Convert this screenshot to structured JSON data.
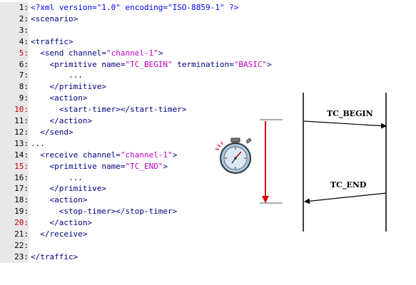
{
  "colors": {
    "tag": "#000080",
    "string": "#c000c0",
    "decl": "#0000ff",
    "red_line": "#c00000",
    "arrow": "#e00000",
    "gutter": "#e8e8e8"
  },
  "code_lines": [
    {
      "n": "1:",
      "red": false,
      "segs": [
        {
          "t": "<?xml version=\"1.0\" encoding=\"ISO-8859-1\" ?>",
          "c": "decl"
        }
      ]
    },
    {
      "n": "2:",
      "red": false,
      "segs": [
        {
          "t": "<scenario>",
          "c": "tag"
        }
      ]
    },
    {
      "n": "3:",
      "red": false,
      "segs": []
    },
    {
      "n": "4:",
      "red": false,
      "segs": [
        {
          "t": "<traffic>",
          "c": "tag"
        }
      ]
    },
    {
      "n": "5:",
      "red": true,
      "segs": [
        {
          "t": "  <send channel=",
          "c": "tag"
        },
        {
          "t": "\"channel-1\"",
          "c": "string"
        },
        {
          "t": ">",
          "c": "tag"
        }
      ]
    },
    {
      "n": "6:",
      "red": false,
      "segs": [
        {
          "t": "    <primitive name=",
          "c": "tag"
        },
        {
          "t": "\"TC_BEGIN\"",
          "c": "string"
        },
        {
          "t": " termination=",
          "c": "tag"
        },
        {
          "t": "\"BASIC\"",
          "c": "string"
        },
        {
          "t": ">",
          "c": "tag"
        }
      ]
    },
    {
      "n": "7:",
      "red": false,
      "segs": [
        {
          "t": "        ...",
          "c": "plain"
        }
      ]
    },
    {
      "n": "8:",
      "red": false,
      "segs": [
        {
          "t": "    </primitive>",
          "c": "tag"
        }
      ]
    },
    {
      "n": "9:",
      "red": false,
      "segs": [
        {
          "t": "    <action>",
          "c": "tag"
        }
      ]
    },
    {
      "n": "10:",
      "red": true,
      "segs": [
        {
          "t": "      <start-timer></start-timer>",
          "c": "tag"
        }
      ]
    },
    {
      "n": "11:",
      "red": false,
      "segs": [
        {
          "t": "    </action>",
          "c": "tag"
        }
      ]
    },
    {
      "n": "12:",
      "red": false,
      "segs": [
        {
          "t": "  </send>",
          "c": "tag"
        }
      ]
    },
    {
      "n": "13:",
      "red": false,
      "segs": [
        {
          "t": "...",
          "c": "plain"
        }
      ]
    },
    {
      "n": "14:",
      "red": false,
      "segs": [
        {
          "t": "  <receive channel=",
          "c": "tag"
        },
        {
          "t": "\"channel-1\"",
          "c": "string"
        },
        {
          "t": ">",
          "c": "tag"
        }
      ]
    },
    {
      "n": "15:",
      "red": true,
      "segs": [
        {
          "t": "    <primitive name=",
          "c": "tag"
        },
        {
          "t": "\"TC_END\"",
          "c": "string"
        },
        {
          "t": ">",
          "c": "tag"
        }
      ]
    },
    {
      "n": "16:",
      "red": false,
      "segs": [
        {
          "t": "        ...",
          "c": "plain"
        }
      ]
    },
    {
      "n": "17:",
      "red": false,
      "segs": [
        {
          "t": "    </primitive>",
          "c": "tag"
        }
      ]
    },
    {
      "n": "18:",
      "red": false,
      "segs": [
        {
          "t": "    <action>",
          "c": "tag"
        }
      ]
    },
    {
      "n": "19:",
      "red": false,
      "segs": [
        {
          "t": "      <stop-timer></stop-timer>",
          "c": "tag"
        }
      ]
    },
    {
      "n": "20:",
      "red": true,
      "segs": [
        {
          "t": "    </action>",
          "c": "tag"
        }
      ]
    },
    {
      "n": "21:",
      "red": false,
      "segs": [
        {
          "t": "  </receive>",
          "c": "tag"
        }
      ]
    },
    {
      "n": "22:",
      "red": false,
      "segs": []
    },
    {
      "n": "23:",
      "red": false,
      "segs": [
        {
          "t": "</traffic>",
          "c": "tag"
        }
      ]
    }
  ],
  "diagram": {
    "message_begin": "TC_BEGIN",
    "message_end": "TC_END",
    "timer_icon": "stopwatch-icon"
  }
}
